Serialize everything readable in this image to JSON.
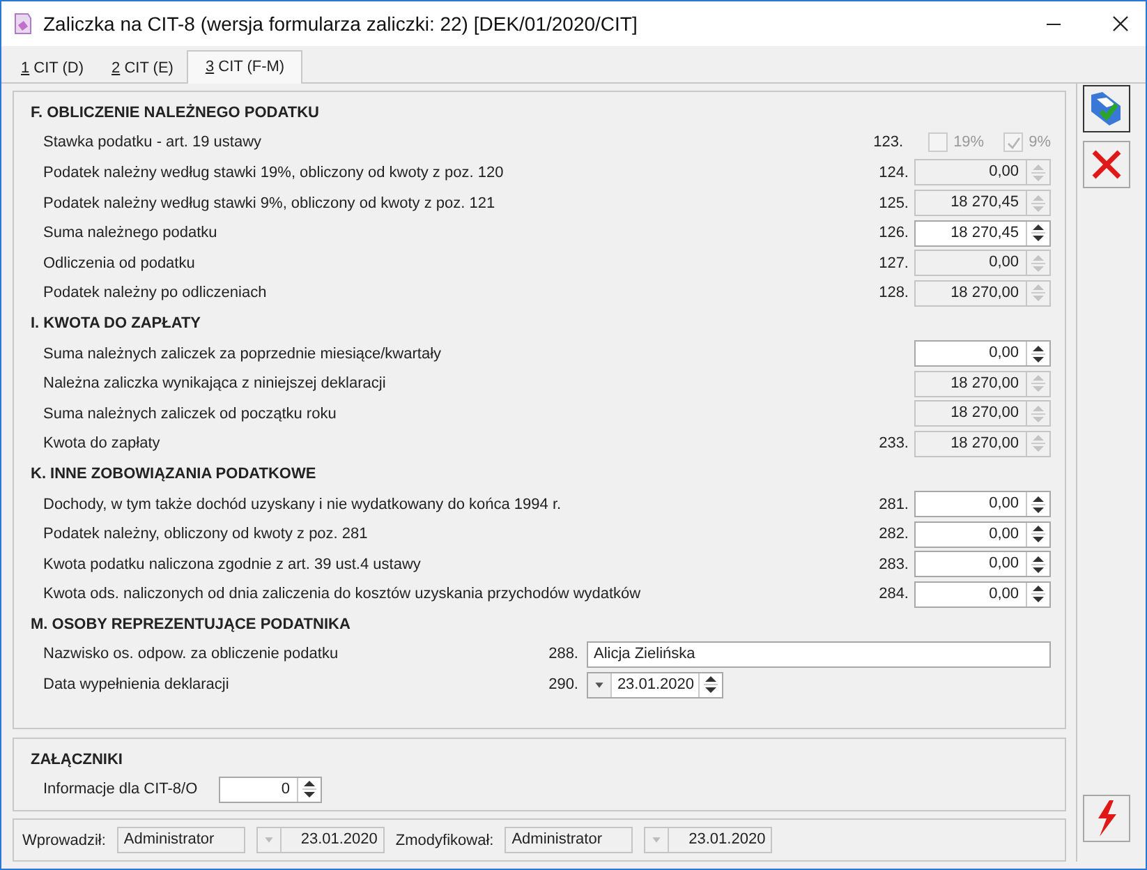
{
  "window": {
    "title": "Zaliczka na CIT-8 (wersja formularza zaliczki: 22) [DEK/01/2020/CIT]"
  },
  "tabs": [
    {
      "label": "1 CIT (D)",
      "selected": false
    },
    {
      "label": "2 CIT (E)",
      "selected": false
    },
    {
      "label": "3 CIT (F-M)",
      "selected": true
    }
  ],
  "sections": [
    {
      "title": "F. OBLICZENIE NALEŻNEGO PODATKU",
      "rows": [
        {
          "kind": "checks",
          "label": "Stawka podatku - art. 19 ustawy",
          "number": "123.",
          "options": [
            {
              "label": "19%",
              "checked": false,
              "disabled": true
            },
            {
              "label": "9%",
              "checked": true,
              "disabled": true
            }
          ]
        },
        {
          "kind": "spin",
          "label": "Podatek należny według stawki 19%, obliczony od kwoty z poz. 120",
          "number": "124.",
          "value": "0,00",
          "disabled": true
        },
        {
          "kind": "spin",
          "label": "Podatek należny według stawki 9%, obliczony od kwoty z poz. 121",
          "number": "125.",
          "value": "18 270,45",
          "disabled": true
        },
        {
          "kind": "spin",
          "label": "Suma należnego podatku",
          "number": "126.",
          "value": "18 270,45",
          "disabled": false
        },
        {
          "kind": "spin",
          "label": "Odliczenia od podatku",
          "number": "127.",
          "value": "0,00",
          "disabled": true
        },
        {
          "kind": "spin",
          "label": "Podatek należny po odliczeniach",
          "number": "128.",
          "value": "18 270,00",
          "disabled": true
        }
      ]
    },
    {
      "title": "I. KWOTA DO ZAPŁATY",
      "rows": [
        {
          "kind": "spin",
          "label": "Suma należnych zaliczek za poprzednie miesiące/kwartały",
          "value": "0,00",
          "disabled": false
        },
        {
          "kind": "spin",
          "label": "Należna zaliczka wynikająca z niniejszej deklaracji",
          "value": "18 270,00",
          "disabled": true
        },
        {
          "kind": "spin",
          "label": "Suma należnych zaliczek od początku roku",
          "value": "18 270,00",
          "disabled": true
        },
        {
          "kind": "spin",
          "label": "Kwota do zapłaty",
          "number": "233.",
          "value": "18 270,00",
          "disabled": true
        }
      ]
    },
    {
      "title": "K. INNE ZOBOWIĄZANIA PODATKOWE",
      "rows": [
        {
          "kind": "spin",
          "label": "Dochody, w tym także dochód uzyskany i nie wydatkowany do końca 1994 r.",
          "number": "281.",
          "value": "0,00",
          "disabled": false
        },
        {
          "kind": "spin",
          "label": "Podatek należny, obliczony od kwoty z poz. 281",
          "number": "282.",
          "value": "0,00",
          "disabled": false
        },
        {
          "kind": "spin",
          "label": "Kwota podatku naliczona zgodnie z art. 39 ust.4 ustawy",
          "number": "283.",
          "value": "0,00",
          "disabled": false
        },
        {
          "kind": "spin",
          "label": "Kwota ods. naliczonych od dnia zaliczenia do kosztów uzyskania przychodów wydatków",
          "number": "284.",
          "value": "0,00",
          "disabled": false
        }
      ]
    },
    {
      "title": "M. OSOBY REPREZENTUJĄCE PODATNIKA",
      "rows": [
        {
          "kind": "text",
          "label": "Nazwisko os. odpow. za obliczenie podatku",
          "number": "288.",
          "value": "Alicja Zielińska"
        },
        {
          "kind": "date",
          "label": "Data wypełnienia deklaracji",
          "number": "290.",
          "value": "23.01.2020"
        }
      ]
    }
  ],
  "attachments": {
    "title": "ZAŁĄCZNIKI",
    "label": "Informacje dla CIT-8/O",
    "value": "0"
  },
  "footer": {
    "entered_label": "Wprowadził:",
    "entered_by": "Administrator",
    "entered_date": "23.01.2020",
    "modified_label": "Zmodyfikował:",
    "modified_by": "Administrator",
    "modified_date": "23.01.2020"
  }
}
